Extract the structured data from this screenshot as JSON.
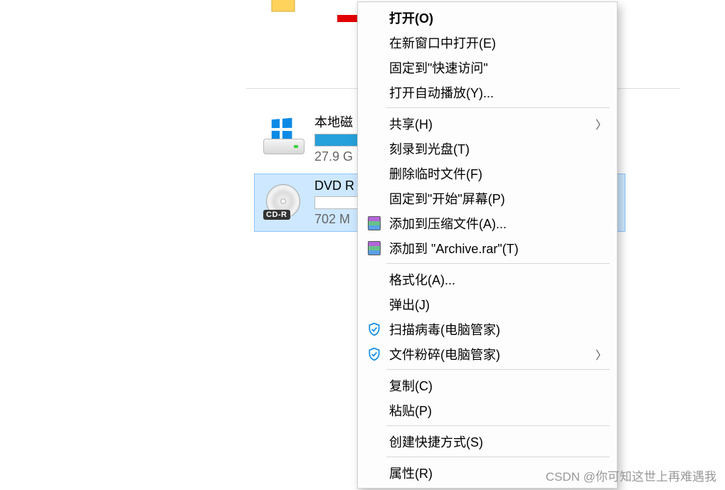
{
  "drives": {
    "local": {
      "title": "本地磁",
      "free": "27.9 G",
      "fill_percent": 100
    },
    "dvd": {
      "title": "DVD R",
      "free": "702 M",
      "cdr_label": "CD-R",
      "fill_percent": 0
    }
  },
  "context_menu": {
    "groups": [
      [
        {
          "label": "打开(O)",
          "bold": true,
          "icon": null,
          "submenu": false,
          "highlighted": true
        },
        {
          "label": "在新窗口中打开(E)",
          "icon": null,
          "submenu": false
        },
        {
          "label": "固定到\"快速访问\"",
          "icon": null,
          "submenu": false
        },
        {
          "label": "打开自动播放(Y)...",
          "icon": null,
          "submenu": false
        }
      ],
      [
        {
          "label": "共享(H)",
          "icon": null,
          "submenu": true
        },
        {
          "label": "刻录到光盘(T)",
          "icon": null,
          "submenu": false
        },
        {
          "label": "删除临时文件(F)",
          "icon": null,
          "submenu": false
        },
        {
          "label": "固定到\"开始\"屏幕(P)",
          "icon": null,
          "submenu": false
        },
        {
          "label": "添加到压缩文件(A)...",
          "icon": "rar",
          "submenu": false
        },
        {
          "label": "添加到 \"Archive.rar\"(T)",
          "icon": "rar",
          "submenu": false
        }
      ],
      [
        {
          "label": "格式化(A)...",
          "icon": null,
          "submenu": false
        },
        {
          "label": "弹出(J)",
          "icon": null,
          "submenu": false
        },
        {
          "label": "扫描病毒(电脑管家)",
          "icon": "shield",
          "submenu": false
        },
        {
          "label": "文件粉碎(电脑管家)",
          "icon": "shield",
          "submenu": true
        }
      ],
      [
        {
          "label": "复制(C)",
          "icon": null,
          "submenu": false
        },
        {
          "label": "粘贴(P)",
          "icon": null,
          "submenu": false
        }
      ],
      [
        {
          "label": "创建快捷方式(S)",
          "icon": null,
          "submenu": false
        }
      ],
      [
        {
          "label": "属性(R)",
          "icon": null,
          "submenu": false
        }
      ]
    ]
  },
  "watermark": "CSDN @你可知这世上再难遇我"
}
